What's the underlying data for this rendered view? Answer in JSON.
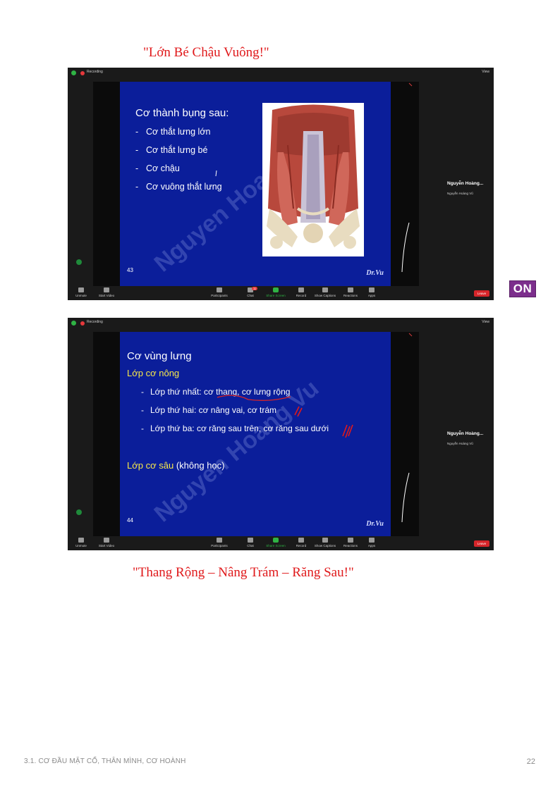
{
  "captions": {
    "top": "\"Lớn Bé Chậu Vuông!\"",
    "bottom": "\"Thang Rộng – Nâng Trám – Răng Sau!\""
  },
  "on_badge": "ON",
  "zoom": {
    "recording_label": "Recording",
    "view_label": "View",
    "participant_name": "Nguyễn Hoàng...",
    "participant_sub": "Nguyễn Hoàng Vũ",
    "leave_label": "Leave",
    "controls": {
      "unmute": "Unmute",
      "start_video": "Start Video",
      "participants": "Participants",
      "participants_count_1": "154",
      "participants_count_2": "157",
      "chat": "Chat",
      "chat_badge": "11",
      "share_screen": "Share Screen",
      "record": "Record",
      "show_captions": "Show Captions",
      "reactions": "Reactions",
      "apps": "Apps"
    }
  },
  "slide1": {
    "title": "Cơ thành bụng sau:",
    "bullets": [
      "Cơ thắt lưng lớn",
      "Cơ thắt lưng bé",
      "Cơ chậu",
      "Cơ vuông thắt lưng"
    ],
    "number": "43",
    "signature": "Dr.Vu",
    "watermark": "Nguyen Hoang Vu"
  },
  "slide2": {
    "title": "Cơ vùng lưng",
    "superficial": "Lớp cơ nông",
    "layers": [
      "Lớp thứ nhất: cơ thang, cơ lưng rộng",
      "Lớp thứ hai: cơ nâng vai, cơ trám",
      "Lớp thứ ba: cơ răng sau trên, cơ răng sau dưới"
    ],
    "deep": "Lớp cơ sâu",
    "deep_note": "(không học)",
    "number": "44",
    "signature": "Dr.Vu",
    "watermark": "Nguyen Hoang Vu"
  },
  "footer": {
    "chapter": "3.1. CƠ ĐẦU MẶT CỔ, THÂN MÌNH, CƠ HOÀNH",
    "page": "22"
  }
}
